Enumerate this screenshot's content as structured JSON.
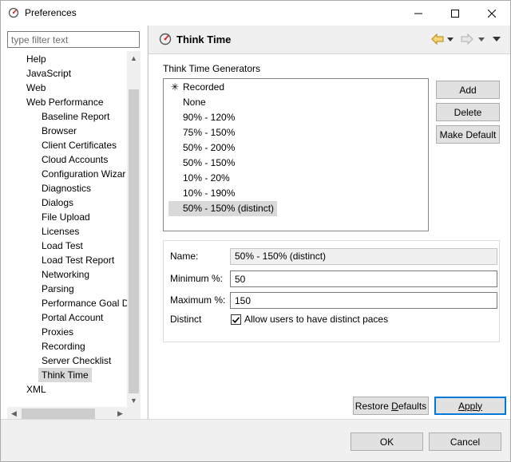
{
  "window": {
    "title": "Preferences"
  },
  "filter": {
    "placeholder": "type filter text"
  },
  "tree": {
    "items": [
      {
        "label": "Help",
        "level": 0
      },
      {
        "label": "JavaScript",
        "level": 0
      },
      {
        "label": "Web",
        "level": 0
      },
      {
        "label": "Web Performance",
        "level": 0
      },
      {
        "label": "Baseline Report",
        "level": 1
      },
      {
        "label": "Browser",
        "level": 1
      },
      {
        "label": "Client Certificates",
        "level": 1
      },
      {
        "label": "Cloud Accounts",
        "level": 1
      },
      {
        "label": "Configuration Wizar",
        "level": 1
      },
      {
        "label": "Diagnostics",
        "level": 1
      },
      {
        "label": "Dialogs",
        "level": 1
      },
      {
        "label": "File Upload",
        "level": 1
      },
      {
        "label": "Licenses",
        "level": 1
      },
      {
        "label": "Load Test",
        "level": 1
      },
      {
        "label": "Load Test Report",
        "level": 1
      },
      {
        "label": "Networking",
        "level": 1
      },
      {
        "label": "Parsing",
        "level": 1
      },
      {
        "label": "Performance Goal D",
        "level": 1
      },
      {
        "label": "Portal Account",
        "level": 1
      },
      {
        "label": "Proxies",
        "level": 1
      },
      {
        "label": "Recording",
        "level": 1
      },
      {
        "label": "Server Checklist",
        "level": 1
      },
      {
        "label": "Think Time",
        "level": 1,
        "selected": true
      },
      {
        "label": "XML",
        "level": 0
      }
    ]
  },
  "page": {
    "title": "Think Time"
  },
  "generators": {
    "label": "Think Time Generators",
    "items": [
      {
        "label": "Recorded",
        "marked": true
      },
      {
        "label": "None"
      },
      {
        "label": "90% - 120%"
      },
      {
        "label": "75% - 150%"
      },
      {
        "label": "50% - 200%"
      },
      {
        "label": "50% - 150%"
      },
      {
        "label": "10% - 20%"
      },
      {
        "label": "10% - 190%"
      },
      {
        "label": "50% - 150% (distinct)",
        "selected": true
      }
    ],
    "add_label": "Add",
    "delete_label": "Delete",
    "make_default_label": "Make Default"
  },
  "details": {
    "name_label": "Name:",
    "name_value": "50% - 150% (distinct)",
    "minimum_label": "Minimum %:",
    "minimum_value": "50",
    "maximum_label": "Maximum %:",
    "maximum_value": "150",
    "distinct_label": "Distinct",
    "distinct_checked": true,
    "distinct_checkbox_label": "Allow users to have distinct paces"
  },
  "actions": {
    "restore_pre": "Restore ",
    "restore_mnemonic": "D",
    "restore_post": "efaults",
    "apply_mnemonic": "A",
    "apply_post": "pply",
    "ok_label": "OK",
    "cancel_label": "Cancel"
  },
  "colors": {
    "accent": "#0078d7",
    "selection": "#d9d9d9",
    "icon_red": "#d32f2f"
  }
}
